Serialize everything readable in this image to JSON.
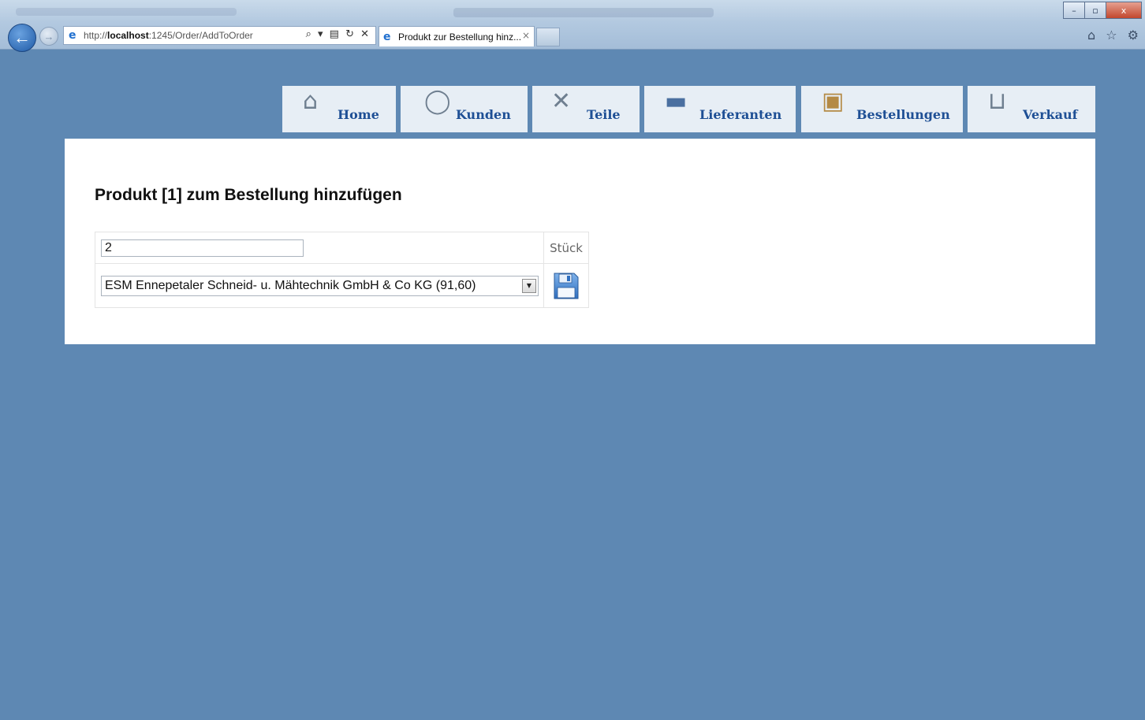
{
  "browser": {
    "url_prefix": "http://",
    "url_host": "localhost",
    "url_path": ":1245/Order/AddToOrder",
    "address_tools": "⌕ ▾ ▤ ↻ ✕",
    "tab_title": "Produkt zur Bestellung hinz...",
    "tab_close": "×",
    "right_tools": "⌂ ☆ ⚙",
    "window_controls": {
      "minimize": "–",
      "maximize": "▫",
      "close": "x"
    }
  },
  "menu": {
    "items": [
      {
        "label": "Home",
        "icon": "house-icon"
      },
      {
        "label": "Kunden",
        "icon": "user-icon"
      },
      {
        "label": "Teile",
        "icon": "tools-icon"
      },
      {
        "label": "Lieferanten",
        "icon": "truck-icon"
      },
      {
        "label": "Bestellungen",
        "icon": "package-icon"
      },
      {
        "label": "Verkauf",
        "icon": "cart-icon"
      }
    ]
  },
  "page": {
    "title": "Produkt [1] zum Bestellung hinzufügen",
    "quantity_value": "2",
    "unit_label": "Stück",
    "supplier_selected": "ESM Ennepetaler Schneid- u. Mähtechnik GmbH & Co KG (91,60)",
    "save_icon": "floppy-disk-icon"
  },
  "colors": {
    "background": "#5e88b3",
    "menu_background": "#e7eef5",
    "menu_text": "#1e4f95",
    "content_background": "#ffffff"
  }
}
